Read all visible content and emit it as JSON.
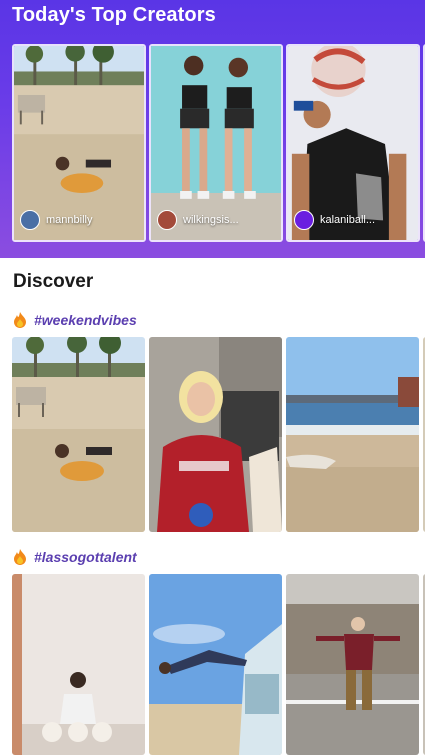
{
  "top_creators": {
    "title": "Today's Top Creators",
    "creators": [
      {
        "handle": "mannbilly",
        "avatar_color": "#4a6fa5"
      },
      {
        "handle": "wilkingsis...",
        "avatar_color": "#a34a3a"
      },
      {
        "handle": "kalaniball...",
        "avatar_color": "#6a1fe0"
      }
    ]
  },
  "discover": {
    "title": "Discover",
    "sections": [
      {
        "icon": "fire-icon",
        "hashtag": "#weekendvibes"
      },
      {
        "icon": "fire-icon",
        "hashtag": "#lassogottalent"
      }
    ]
  },
  "colors": {
    "header_gradient_start": "#5a35e6",
    "header_gradient_end": "#8b4de0",
    "hashtag": "#5b3fb0"
  }
}
